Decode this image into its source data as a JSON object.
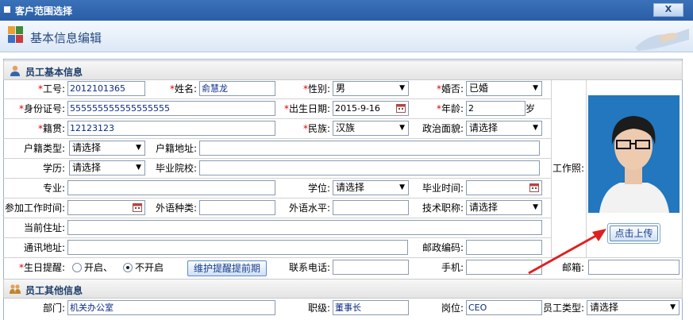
{
  "window": {
    "title": "客户范围选择",
    "close_label": "X"
  },
  "header": {
    "title": "基本信息编辑"
  },
  "sections": {
    "basic": "员工基本信息",
    "other": "员工其他信息"
  },
  "fields": {
    "emp_no": {
      "label": "工号",
      "value": "2012101365"
    },
    "name": {
      "label": "姓名",
      "value": "俞慧龙"
    },
    "gender": {
      "label": "性别",
      "value": "男"
    },
    "married": {
      "label": "婚否",
      "value": "已婚"
    },
    "id_no": {
      "label": "身份证号",
      "value": "555555555555555555"
    },
    "birth": {
      "label": "出生日期",
      "value": "2015-9-16"
    },
    "age": {
      "label": "年龄",
      "value": "2",
      "unit": "岁"
    },
    "native": {
      "label": "籍贯",
      "value": "12123123"
    },
    "nation": {
      "label": "民族",
      "value": "汉族"
    },
    "political": {
      "label": "政治面貌",
      "value": "请选择"
    },
    "hukou_type": {
      "label": "户籍类型",
      "value": "请选择"
    },
    "hukou_addr": {
      "label": "户籍地址",
      "value": ""
    },
    "edu": {
      "label": "学历",
      "value": "请选择"
    },
    "school": {
      "label": "毕业院校",
      "value": ""
    },
    "major": {
      "label": "专业",
      "value": ""
    },
    "degree": {
      "label": "学位",
      "value": "请选择"
    },
    "grad_time": {
      "label": "毕业时间",
      "value": ""
    },
    "work_start": {
      "label": "参加工作时间",
      "value": ""
    },
    "lang_type": {
      "label": "外语种类",
      "value": ""
    },
    "lang_level": {
      "label": "外语水平",
      "value": ""
    },
    "tech_title": {
      "label": "技术职称",
      "value": "请选择"
    },
    "cur_addr": {
      "label": "当前住址",
      "value": ""
    },
    "mail_addr": {
      "label": "通讯地址",
      "value": ""
    },
    "postcode": {
      "label": "邮政编码",
      "value": ""
    },
    "bday_remind": {
      "label": "生日提醒",
      "opt_on": "开启、",
      "opt_off": "不开启",
      "button": "维护提醒提前期"
    },
    "phone": {
      "label": "联系电话",
      "value": ""
    },
    "mobile": {
      "label": "手机",
      "value": ""
    },
    "email": {
      "label": "邮箱",
      "value": ""
    },
    "photo": {
      "label": "工作照",
      "upload_button": "点击上传"
    },
    "dept": {
      "label": "部门",
      "value": "机关办公室"
    },
    "rank": {
      "label": "职级",
      "value": "董事长"
    },
    "post": {
      "label": "岗位",
      "value": "CEO"
    },
    "emp_type": {
      "label": "员工类型",
      "value": "请选择"
    }
  },
  "colors": {
    "accent": "#2a5ea8",
    "required": "#e00000",
    "arrow": "#e02020"
  }
}
